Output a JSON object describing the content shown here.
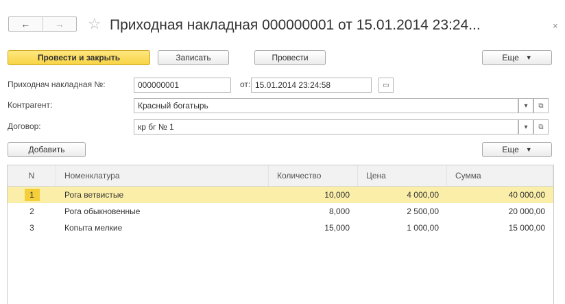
{
  "nav": {
    "back_icon": "←",
    "forward_icon": "→",
    "star_icon": "☆",
    "close_icon": "×"
  },
  "title": "Приходная накладная 000000001 от 15.01.2014 23:24...",
  "toolbar": {
    "post_close": "Провести и закрыть",
    "save": "Записать",
    "post": "Провести",
    "more": "Еще",
    "caret": "▼"
  },
  "header": {
    "number_label": "Приходнач накладная №:",
    "number_value": "000000001",
    "date_label": "от:",
    "date_value": "15.01.2014 23:24:58",
    "calendar_icon": "▭",
    "counterparty_label": "Контрагент:",
    "counterparty_value": "Красный богатырь",
    "contract_label": "Договор:",
    "contract_value": "кр бг № 1",
    "dropdown_icon": "▾",
    "open_icon": "⧉"
  },
  "table_toolbar": {
    "add": "Добавить",
    "more": "Еще",
    "caret": "▼"
  },
  "table": {
    "columns": [
      "N",
      "Номенклатура",
      "Количество",
      "Цена",
      "Сумма"
    ],
    "rows": [
      {
        "n": "1",
        "item": "Рога ветвистые",
        "qty": "10,000",
        "price": "4 000,00",
        "sum": "40 000,00"
      },
      {
        "n": "2",
        "item": "Рога обыкновенные",
        "qty": "8,000",
        "price": "2 500,00",
        "sum": "20 000,00"
      },
      {
        "n": "3",
        "item": "Копыта мелкие",
        "qty": "15,000",
        "price": "1 000,00",
        "sum": "15 000,00"
      }
    ]
  },
  "colors": {
    "primary_button": "#f7d445",
    "selected_row": "#fbeea8"
  }
}
